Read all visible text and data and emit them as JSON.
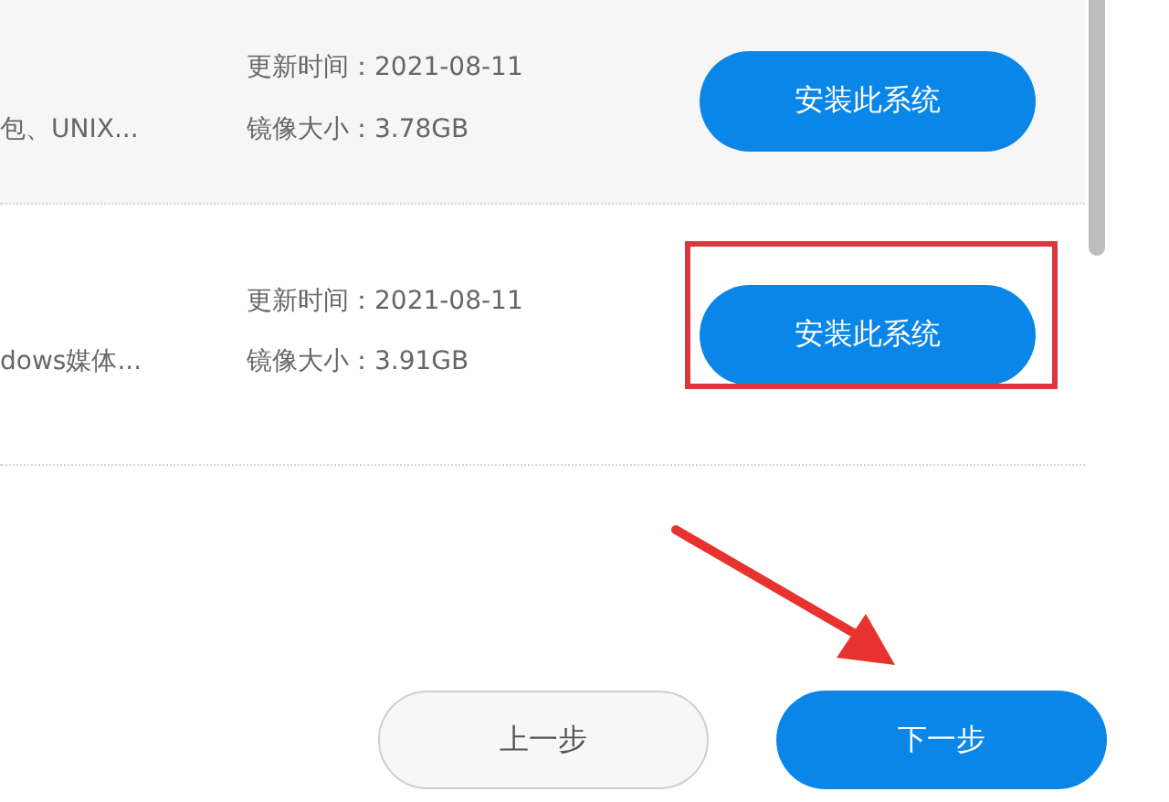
{
  "systems": [
    {
      "description": "包、UNIX...",
      "updated": "更新时间：2021-08-11",
      "size": "镜像大小：3.78GB",
      "button": "安装此系统",
      "highlighted": true,
      "annotated": false
    },
    {
      "description": "dows媒体...",
      "updated": "更新时间：2021-08-11",
      "size": "镜像大小：3.91GB",
      "button": "安装此系统",
      "highlighted": false,
      "annotated": true
    }
  ],
  "prev_button": "上一步",
  "next_button": "下一步"
}
